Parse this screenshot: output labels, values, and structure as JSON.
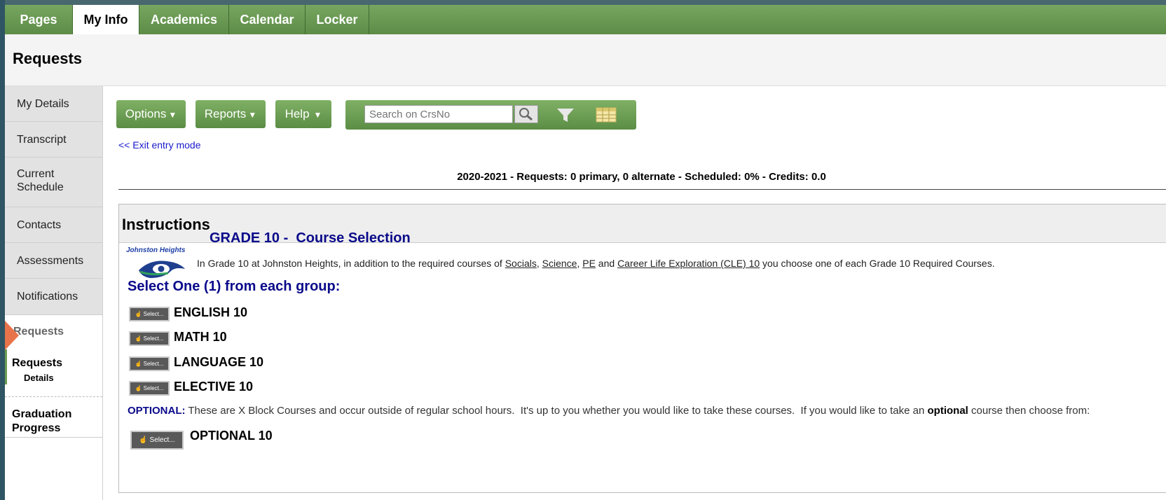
{
  "tabs": [
    "Pages",
    "My Info",
    "Academics",
    "Calendar",
    "Locker"
  ],
  "page_title": "Requests",
  "sidenav": {
    "items": [
      "My Details",
      "Transcript",
      "Current",
      "Schedule",
      "Contacts",
      "Assessments",
      "Notifications"
    ],
    "section_label": "Requests",
    "sub_title": "Requests",
    "sub_detail": "Details",
    "grad_line1": "Graduation",
    "grad_line2": "Progress"
  },
  "toolbar": {
    "options": "Options",
    "reports": "Reports",
    "help": "Help",
    "search_placeholder": "Search on CrsNo"
  },
  "exit_link": "<< Exit entry mode",
  "summary": "2020-2021 - Requests: 0 primary, 0 alternate - Scheduled: 0% - Credits: 0.0",
  "instructions": {
    "title": "Instructions",
    "logo_text": "Johnston Heights",
    "heading": "GRADE 10 -  Course Selection",
    "intro_pre": "In Grade 10 at Johnston Heights, in addition to the required courses of ",
    "intro_socials": "Socials",
    "intro_comma1": ", ",
    "intro_science": "Science",
    "intro_comma2": ", ",
    "intro_pe": "PE",
    "intro_and": " and ",
    "intro_cle": "Career Life Exploration (CLE) 10",
    "intro_post": " you choose one of each Grade 10 Required Courses.",
    "select_heading": "Select One (1) from each group:",
    "select_label": "Select...",
    "courses": [
      "ENGLISH 10",
      "MATH 10",
      "LANGUAGE 10",
      "ELECTIVE 10"
    ],
    "optional_label": "OPTIONAL:",
    "optional_text": " These are X Block Courses and occur outside of regular school hours.  It's up to you whether you would like to take these courses.  If you would like to take an ",
    "optional_bold": "optional",
    "optional_tail": " course then choose from:",
    "optional_course": "OPTIONAL 10"
  },
  "colors": {
    "accent_green": "#6a9b53",
    "link_blue": "#1a1acc",
    "heading_navy": "#0a0a8a",
    "arrow": "#e8734a"
  }
}
